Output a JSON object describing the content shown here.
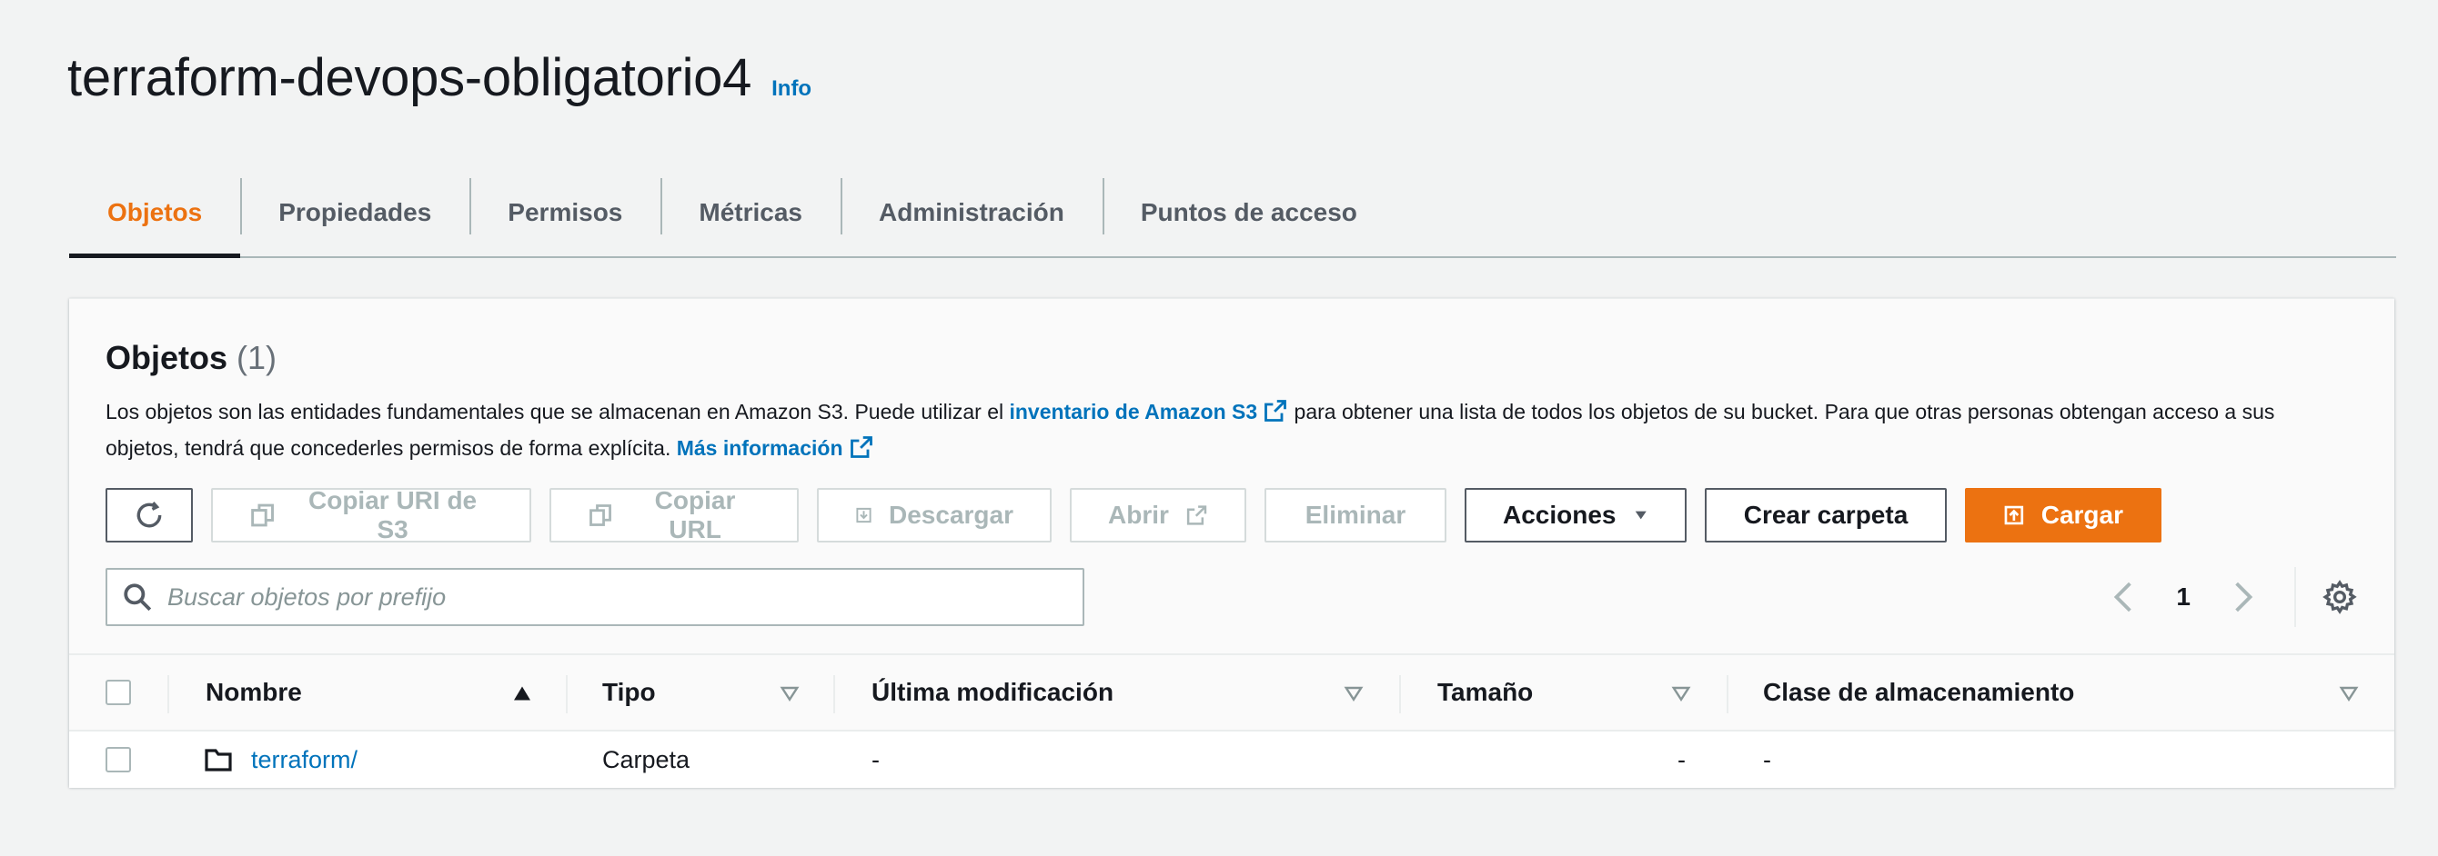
{
  "bucket": {
    "name": "terraform-devops-obligatorio4",
    "info_label": "Info"
  },
  "tabs": [
    {
      "label": "Objetos",
      "active": true
    },
    {
      "label": "Propiedades"
    },
    {
      "label": "Permisos"
    },
    {
      "label": "Métricas"
    },
    {
      "label": "Administración"
    },
    {
      "label": "Puntos de acceso"
    }
  ],
  "objects": {
    "title": "Objetos",
    "count": "(1)",
    "description_1": "Los objetos son las entidades fundamentales que se almacenan en Amazon S3. Puede utilizar el",
    "inventory_link": "inventario de Amazon S3",
    "description_2": "para obtener una lista de todos los objetos de su bucket. Para que otras personas obtengan acceso a sus objetos, tendrá que concederles permisos de forma explícita.",
    "more_info_link": "Más información"
  },
  "toolbar": {
    "copy_s3_uri": "Copiar URI de S3",
    "copy_url": "Copiar URL",
    "download": "Descargar",
    "open": "Abrir",
    "delete": "Eliminar",
    "actions": "Acciones",
    "create_folder": "Crear carpeta",
    "upload": "Cargar"
  },
  "search": {
    "placeholder": "Buscar objetos por prefijo"
  },
  "pagination": {
    "page": "1"
  },
  "table": {
    "columns": {
      "name": "Nombre",
      "type": "Tipo",
      "last_modified": "Última modificación",
      "size": "Tamaño",
      "storage_class": "Clase de almacenamiento"
    },
    "rows": [
      {
        "name": "terraform/",
        "type": "Carpeta",
        "last_modified": "-",
        "size": "-",
        "storage_class": "-"
      }
    ]
  },
  "colors": {
    "accent": "#ec7211",
    "link": "#0073bb",
    "text": "#16191f",
    "background": "#f2f3f3"
  }
}
